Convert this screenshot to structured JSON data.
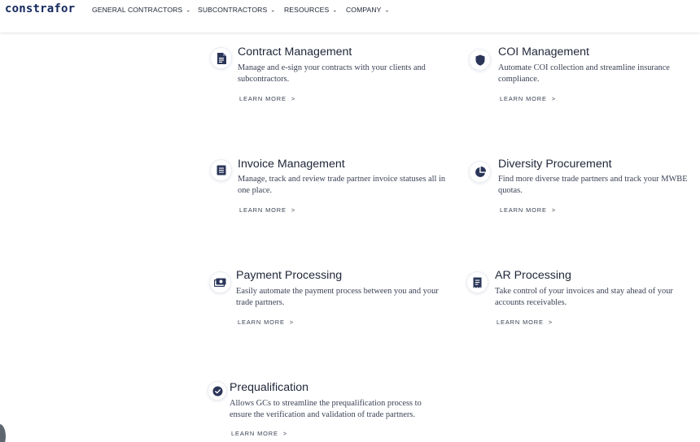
{
  "header": {
    "logo": "constrafor",
    "nav": [
      {
        "label": "GENERAL CONTRACTORS"
      },
      {
        "label": "SUBCONTRACTORS"
      },
      {
        "label": "RESOURCES"
      },
      {
        "label": "COMPANY"
      }
    ],
    "chevron_icon": "chevron-down-icon"
  },
  "features": [
    {
      "title": "Contract Management",
      "desc": "Manage and e-sign your contracts with your clients and subcontractors.",
      "link": "LEARN MORE",
      "icon": "document-icon"
    },
    {
      "title": "COI Management",
      "desc": "Automate COI collection and streamline insurance compliance.",
      "link": "LEARN MORE",
      "icon": "shield-icon"
    },
    {
      "title": "Invoice Management",
      "desc": "Manage, track and review trade partner invoice statuses all in one place.",
      "link": "LEARN MORE",
      "icon": "invoice-icon"
    },
    {
      "title": "Diversity Procurement",
      "desc": "Find more diverse trade partners and track your MWBE quotas.",
      "link": "LEARN MORE",
      "icon": "pie-chart-icon"
    },
    {
      "title": "Payment Processing",
      "desc": "Easily automate the payment process between you and your trade partners.",
      "link": "LEARN MORE",
      "icon": "money-icon"
    },
    {
      "title": "AR Processing",
      "desc": "Take control of your invoices and stay ahead of your accounts receivables.",
      "link": "LEARN MORE",
      "icon": "receipt-icon"
    },
    {
      "title": "Prequalification",
      "desc": "Allows GCs to streamline the prequalification process to ensure the verification and validation of trade partners.",
      "link": "LEARN MORE",
      "icon": "check-badge-icon"
    }
  ],
  "colors": {
    "brand": "#14285e",
    "icon": "#2a3558",
    "text": "#1f2638"
  }
}
